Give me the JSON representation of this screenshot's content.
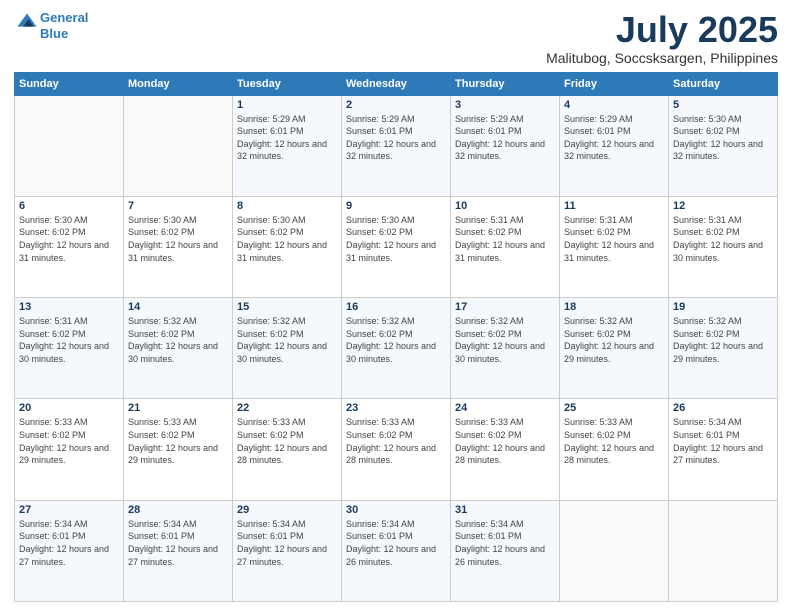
{
  "logo": {
    "line1": "General",
    "line2": "Blue"
  },
  "title": "July 2025",
  "subtitle": "Malitubog, Soccsksargen, Philippines",
  "weekdays": [
    "Sunday",
    "Monday",
    "Tuesday",
    "Wednesday",
    "Thursday",
    "Friday",
    "Saturday"
  ],
  "weeks": [
    [
      {
        "day": "",
        "info": ""
      },
      {
        "day": "",
        "info": ""
      },
      {
        "day": "1",
        "info": "Sunrise: 5:29 AM\nSunset: 6:01 PM\nDaylight: 12 hours and 32 minutes."
      },
      {
        "day": "2",
        "info": "Sunrise: 5:29 AM\nSunset: 6:01 PM\nDaylight: 12 hours and 32 minutes."
      },
      {
        "day": "3",
        "info": "Sunrise: 5:29 AM\nSunset: 6:01 PM\nDaylight: 12 hours and 32 minutes."
      },
      {
        "day": "4",
        "info": "Sunrise: 5:29 AM\nSunset: 6:01 PM\nDaylight: 12 hours and 32 minutes."
      },
      {
        "day": "5",
        "info": "Sunrise: 5:30 AM\nSunset: 6:02 PM\nDaylight: 12 hours and 32 minutes."
      }
    ],
    [
      {
        "day": "6",
        "info": "Sunrise: 5:30 AM\nSunset: 6:02 PM\nDaylight: 12 hours and 31 minutes."
      },
      {
        "day": "7",
        "info": "Sunrise: 5:30 AM\nSunset: 6:02 PM\nDaylight: 12 hours and 31 minutes."
      },
      {
        "day": "8",
        "info": "Sunrise: 5:30 AM\nSunset: 6:02 PM\nDaylight: 12 hours and 31 minutes."
      },
      {
        "day": "9",
        "info": "Sunrise: 5:30 AM\nSunset: 6:02 PM\nDaylight: 12 hours and 31 minutes."
      },
      {
        "day": "10",
        "info": "Sunrise: 5:31 AM\nSunset: 6:02 PM\nDaylight: 12 hours and 31 minutes."
      },
      {
        "day": "11",
        "info": "Sunrise: 5:31 AM\nSunset: 6:02 PM\nDaylight: 12 hours and 31 minutes."
      },
      {
        "day": "12",
        "info": "Sunrise: 5:31 AM\nSunset: 6:02 PM\nDaylight: 12 hours and 30 minutes."
      }
    ],
    [
      {
        "day": "13",
        "info": "Sunrise: 5:31 AM\nSunset: 6:02 PM\nDaylight: 12 hours and 30 minutes."
      },
      {
        "day": "14",
        "info": "Sunrise: 5:32 AM\nSunset: 6:02 PM\nDaylight: 12 hours and 30 minutes."
      },
      {
        "day": "15",
        "info": "Sunrise: 5:32 AM\nSunset: 6:02 PM\nDaylight: 12 hours and 30 minutes."
      },
      {
        "day": "16",
        "info": "Sunrise: 5:32 AM\nSunset: 6:02 PM\nDaylight: 12 hours and 30 minutes."
      },
      {
        "day": "17",
        "info": "Sunrise: 5:32 AM\nSunset: 6:02 PM\nDaylight: 12 hours and 30 minutes."
      },
      {
        "day": "18",
        "info": "Sunrise: 5:32 AM\nSunset: 6:02 PM\nDaylight: 12 hours and 29 minutes."
      },
      {
        "day": "19",
        "info": "Sunrise: 5:32 AM\nSunset: 6:02 PM\nDaylight: 12 hours and 29 minutes."
      }
    ],
    [
      {
        "day": "20",
        "info": "Sunrise: 5:33 AM\nSunset: 6:02 PM\nDaylight: 12 hours and 29 minutes."
      },
      {
        "day": "21",
        "info": "Sunrise: 5:33 AM\nSunset: 6:02 PM\nDaylight: 12 hours and 29 minutes."
      },
      {
        "day": "22",
        "info": "Sunrise: 5:33 AM\nSunset: 6:02 PM\nDaylight: 12 hours and 28 minutes."
      },
      {
        "day": "23",
        "info": "Sunrise: 5:33 AM\nSunset: 6:02 PM\nDaylight: 12 hours and 28 minutes."
      },
      {
        "day": "24",
        "info": "Sunrise: 5:33 AM\nSunset: 6:02 PM\nDaylight: 12 hours and 28 minutes."
      },
      {
        "day": "25",
        "info": "Sunrise: 5:33 AM\nSunset: 6:02 PM\nDaylight: 12 hours and 28 minutes."
      },
      {
        "day": "26",
        "info": "Sunrise: 5:34 AM\nSunset: 6:01 PM\nDaylight: 12 hours and 27 minutes."
      }
    ],
    [
      {
        "day": "27",
        "info": "Sunrise: 5:34 AM\nSunset: 6:01 PM\nDaylight: 12 hours and 27 minutes."
      },
      {
        "day": "28",
        "info": "Sunrise: 5:34 AM\nSunset: 6:01 PM\nDaylight: 12 hours and 27 minutes."
      },
      {
        "day": "29",
        "info": "Sunrise: 5:34 AM\nSunset: 6:01 PM\nDaylight: 12 hours and 27 minutes."
      },
      {
        "day": "30",
        "info": "Sunrise: 5:34 AM\nSunset: 6:01 PM\nDaylight: 12 hours and 26 minutes."
      },
      {
        "day": "31",
        "info": "Sunrise: 5:34 AM\nSunset: 6:01 PM\nDaylight: 12 hours and 26 minutes."
      },
      {
        "day": "",
        "info": ""
      },
      {
        "day": "",
        "info": ""
      }
    ]
  ]
}
